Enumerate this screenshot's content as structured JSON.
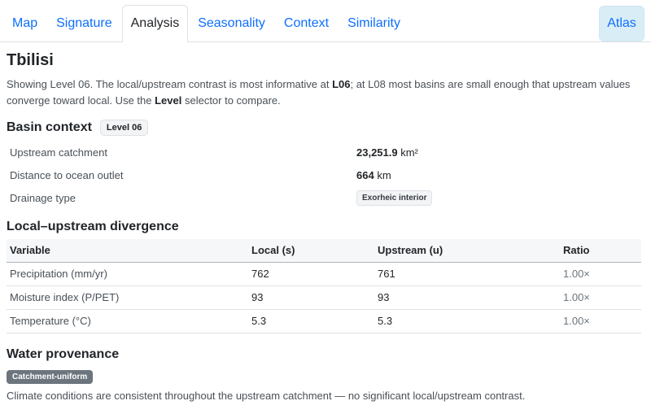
{
  "tabs": [
    {
      "label": "Map"
    },
    {
      "label": "Signature"
    },
    {
      "label": "Analysis",
      "active": true
    },
    {
      "label": "Seasonality"
    },
    {
      "label": "Context"
    },
    {
      "label": "Similarity"
    }
  ],
  "atlas_label": "Atlas",
  "title": "Tbilisi",
  "intro": {
    "p1": "Showing Level 06. The local/upstream contrast is most informative at ",
    "b1": "L06",
    "p2": "; at L08 most basins are small enough that upstream values converge toward local. Use the ",
    "b2": "Level",
    "p3": " selector to compare."
  },
  "basin_context": {
    "heading": "Basin context",
    "level_badge": "Level 06",
    "rows": [
      {
        "label": "Upstream catchment",
        "value": "23,251.9",
        "unit": " km²"
      },
      {
        "label": "Distance to ocean outlet",
        "value": "664",
        "unit": " km"
      },
      {
        "label": "Drainage type",
        "chip": "Exorheic interior"
      }
    ]
  },
  "divergence": {
    "heading": "Local–upstream divergence",
    "columns": [
      "Variable",
      "Local (s)",
      "Upstream (u)",
      "Ratio"
    ],
    "rows": [
      [
        "Precipitation (mm/yr)",
        "762",
        "761",
        "1.00×"
      ],
      [
        "Moisture index (P/PET)",
        "93",
        "93",
        "1.00×"
      ],
      [
        "Temperature (°C)",
        "5.3",
        "5.3",
        "1.00×"
      ]
    ]
  },
  "provenance": {
    "heading": "Water provenance",
    "badge": "Catchment-uniform",
    "text": "Climate conditions are consistent throughout the upstream catchment — no significant local/upstream contrast."
  }
}
